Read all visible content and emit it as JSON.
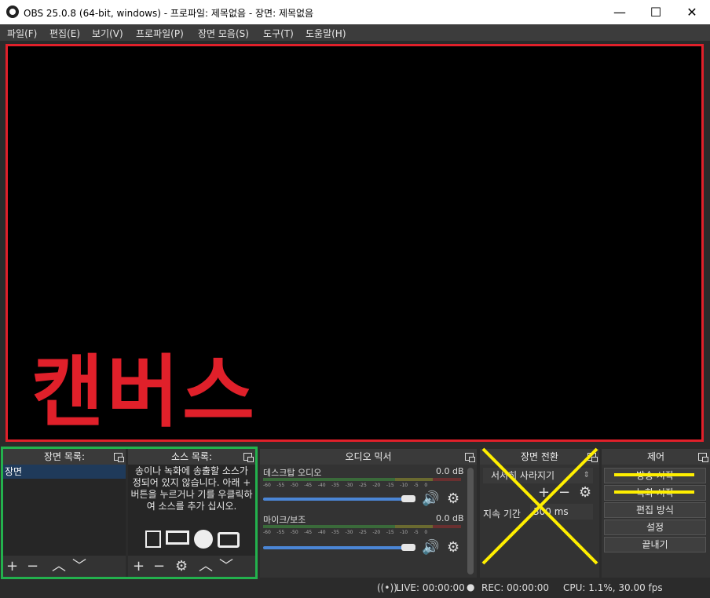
{
  "window": {
    "title": "OBS 25.0.8 (64-bit, windows) - 프로파일: 제목없음 - 장면: 제목없음",
    "minimize": "—",
    "maximize": "☐",
    "close": "✕"
  },
  "menu": [
    "파일(F)",
    "편집(E)",
    "보기(V)",
    "프로파일(P)",
    "장면 모음(S)",
    "도구(T)",
    "도움말(H)"
  ],
  "canvas": {
    "label": "캔버스",
    "label_color": "#e0202a",
    "border_color": "#e0202a"
  },
  "scenes": {
    "title": "장면 목록:",
    "items": [
      "장면"
    ]
  },
  "sources": {
    "title": "소스 목록:",
    "hint": "송이나 녹화에 송출할 소스가 정되어 있지 않습니다. 아래 + 버튼을 누르거나 기를 우클릭하여 소스를 추가 십시오."
  },
  "mixer": {
    "title": "오디오 믹서",
    "channels": [
      {
        "name": "데스크탑 오디오",
        "db": "0.0 dB",
        "volume": 1.0
      },
      {
        "name": "마이크/보조",
        "db": "0.0 dB",
        "volume": 1.0
      }
    ],
    "scale": [
      "-60",
      "-55",
      "-50",
      "-45",
      "-40",
      "-35",
      "-30",
      "-25",
      "-20",
      "-15",
      "-10",
      "-5",
      "0"
    ]
  },
  "transitions": {
    "title": "장면 전환",
    "selected": "서서히 사라지기",
    "duration_label": "지속 기간",
    "duration_value": "300 ms"
  },
  "controls": {
    "title": "제어",
    "buttons": [
      "방송 시작",
      "녹화 시작",
      "편집 방식",
      "설정",
      "끝내기"
    ]
  },
  "status": {
    "live": "LIVE: 00:00:00",
    "rec": "REC: 00:00:00",
    "cpu": "CPU: 1.1%, 30.00 fps"
  },
  "accent_colors": {
    "green_box": "#23b14d",
    "yellow_marks": "#ffef00",
    "slider": "#4b86d6"
  }
}
